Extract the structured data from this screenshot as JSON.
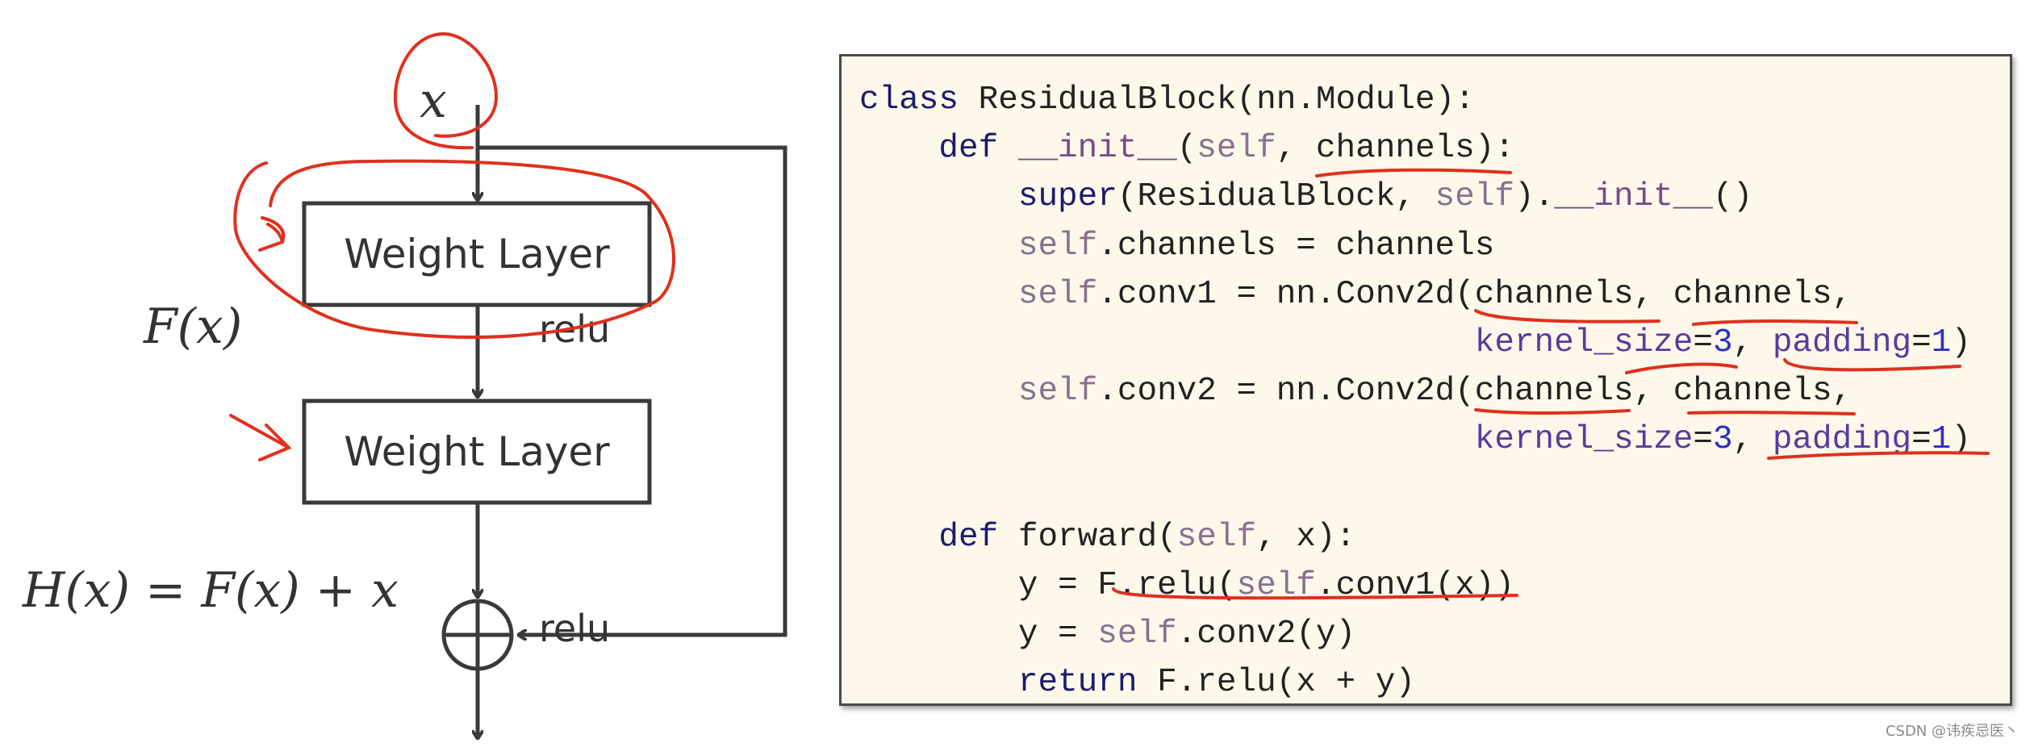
{
  "diagram": {
    "input_label": "x",
    "layer1_label": "Weight Layer",
    "layer2_label": "Weight Layer",
    "fx_label": "F(x)",
    "relu1_label": "relu",
    "relu2_label": "relu",
    "sum_equation": "H(x) = F(x) + x",
    "line_color": "#3a3a3a",
    "annotation_color": "#e0301e"
  },
  "code": {
    "background": "#fdf8ea",
    "lines": [
      [
        {
          "t": "class",
          "c": "kw"
        },
        {
          "t": " ResidualBlock(nn.Module):",
          "c": "plain"
        }
      ],
      [
        {
          "t": "    ",
          "c": "plain"
        },
        {
          "t": "def",
          "c": "kw"
        },
        {
          "t": " ",
          "c": "plain"
        },
        {
          "t": "__init__",
          "c": "dunder"
        },
        {
          "t": "(",
          "c": "plain"
        },
        {
          "t": "self",
          "c": "slf"
        },
        {
          "t": ", channels):",
          "c": "plain"
        }
      ],
      [
        {
          "t": "        ",
          "c": "plain"
        },
        {
          "t": "super",
          "c": "kw"
        },
        {
          "t": "(ResidualBlock, ",
          "c": "plain"
        },
        {
          "t": "self",
          "c": "slf"
        },
        {
          "t": ").",
          "c": "plain"
        },
        {
          "t": "__init__",
          "c": "dunder"
        },
        {
          "t": "()",
          "c": "plain"
        }
      ],
      [
        {
          "t": "        ",
          "c": "plain"
        },
        {
          "t": "self",
          "c": "slf"
        },
        {
          "t": ".channels = channels",
          "c": "plain"
        }
      ],
      [
        {
          "t": "        ",
          "c": "plain"
        },
        {
          "t": "self",
          "c": "slf"
        },
        {
          "t": ".conv1 = nn.Conv2d(channels, channels,",
          "c": "plain"
        }
      ],
      [
        {
          "t": "                               ",
          "c": "plain"
        },
        {
          "t": "kernel_size",
          "c": "kwarg"
        },
        {
          "t": "=",
          "c": "plain"
        },
        {
          "t": "3",
          "c": "num"
        },
        {
          "t": ", ",
          "c": "plain"
        },
        {
          "t": "padding",
          "c": "kwarg"
        },
        {
          "t": "=",
          "c": "plain"
        },
        {
          "t": "1",
          "c": "num"
        },
        {
          "t": ")",
          "c": "plain"
        }
      ],
      [
        {
          "t": "        ",
          "c": "plain"
        },
        {
          "t": "self",
          "c": "slf"
        },
        {
          "t": ".conv2 = nn.Conv2d(channels, channels,",
          "c": "plain"
        }
      ],
      [
        {
          "t": "                               ",
          "c": "plain"
        },
        {
          "t": "kernel_size",
          "c": "kwarg"
        },
        {
          "t": "=",
          "c": "plain"
        },
        {
          "t": "3",
          "c": "num"
        },
        {
          "t": ", ",
          "c": "plain"
        },
        {
          "t": "padding",
          "c": "kwarg"
        },
        {
          "t": "=",
          "c": "plain"
        },
        {
          "t": "1",
          "c": "num"
        },
        {
          "t": ")",
          "c": "plain"
        }
      ],
      [],
      [
        {
          "t": "    ",
          "c": "plain"
        },
        {
          "t": "def",
          "c": "kw"
        },
        {
          "t": " forward(",
          "c": "plain"
        },
        {
          "t": "self",
          "c": "slf"
        },
        {
          "t": ", x):",
          "c": "plain"
        }
      ],
      [
        {
          "t": "        y = F.relu(",
          "c": "plain"
        },
        {
          "t": "self",
          "c": "slf"
        },
        {
          "t": ".conv1(x))",
          "c": "plain"
        }
      ],
      [
        {
          "t": "        y = ",
          "c": "plain"
        },
        {
          "t": "self",
          "c": "slf"
        },
        {
          "t": ".conv2(y)",
          "c": "plain"
        }
      ],
      [
        {
          "t": "        ",
          "c": "plain"
        },
        {
          "t": "return",
          "c": "kw"
        },
        {
          "t": " F.relu(x + y)",
          "c": "plain"
        }
      ]
    ]
  },
  "watermark": "CSDN @讳疾忌医丶"
}
